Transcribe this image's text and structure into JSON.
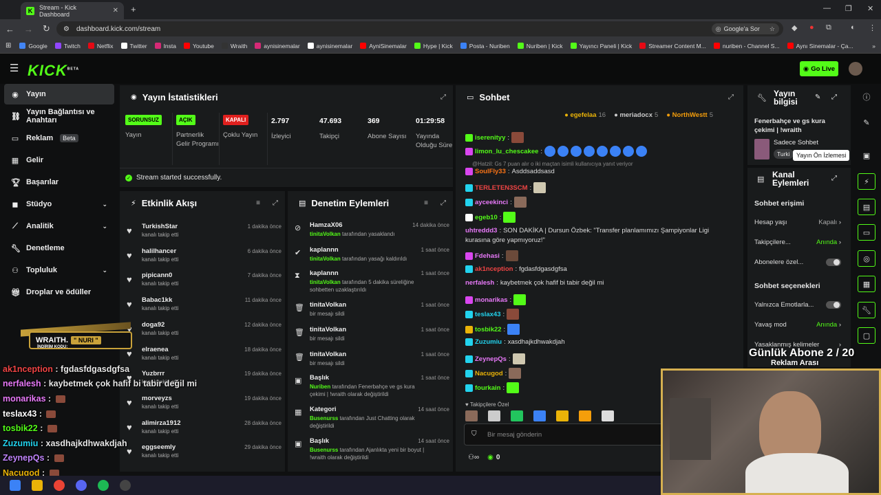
{
  "browser": {
    "tab_title": "Stream - Kick Dashboard",
    "url": "dashboard.kick.com/stream",
    "google_sor": "Google'a Sor",
    "bookmarks": [
      {
        "label": "Google",
        "color": "#4285f4"
      },
      {
        "label": "Twitch",
        "color": "#9146ff"
      },
      {
        "label": "Netflix",
        "color": "#e50914"
      },
      {
        "label": "Twitter",
        "color": "#ffffff"
      },
      {
        "label": "Insta",
        "color": "#d62976"
      },
      {
        "label": "Youtube",
        "color": "#ff0000"
      },
      {
        "label": "Wraith",
        "color": "#333333"
      },
      {
        "label": "aynisinemalar",
        "color": "#d62976"
      },
      {
        "label": "aynisinemalar",
        "color": "#ffffff"
      },
      {
        "label": "AyniSinemalar",
        "color": "#ff0000"
      },
      {
        "label": "Hype | Kick",
        "color": "#53fc18"
      },
      {
        "label": "Posta - Nuriben",
        "color": "#3b82f6"
      },
      {
        "label": "Nuriben | Kick",
        "color": "#53fc18"
      },
      {
        "label": "Yayıncı Paneli | Kick",
        "color": "#53fc18"
      },
      {
        "label": "Streamer Content M...",
        "color": "#e50914"
      },
      {
        "label": "nuriben - Channel S...",
        "color": "#ff0000"
      },
      {
        "label": "Aynı Sinemalar - Ça...",
        "color": "#ff0000"
      }
    ]
  },
  "header": {
    "logo": "KICK",
    "beta": "BETA",
    "go_live": "Go Live"
  },
  "sidebar": [
    {
      "label": "Yayın",
      "icon": "broadcast-icon",
      "active": true
    },
    {
      "label": "Yayın Bağlantısı ve Anahtarı",
      "icon": "link-icon"
    },
    {
      "label": "Reklam",
      "icon": "ad-icon",
      "badge": "Beta"
    },
    {
      "label": "Gelir",
      "icon": "money-icon"
    },
    {
      "label": "Başarılar",
      "icon": "trophy-icon"
    },
    {
      "label": "Stüdyo",
      "icon": "studio-icon",
      "chevron": true
    },
    {
      "label": "Analitik",
      "icon": "chart-icon",
      "chevron": true
    },
    {
      "label": "Denetleme",
      "icon": "wrench-icon"
    },
    {
      "label": "Topluluk",
      "icon": "community-icon",
      "chevron": true
    },
    {
      "label": "Droplar ve ödüller",
      "icon": "gift-icon"
    }
  ],
  "stats": {
    "title": "Yayın İstatistikleri",
    "badges": [
      {
        "badge": "SORUNSUZ",
        "label": "Yayın",
        "color": "#53fc18"
      },
      {
        "badge": "AÇIK",
        "label": "Partnerlik Gelir Programı",
        "color": "#53fc18"
      },
      {
        "badge": "KAPALI",
        "label": "Çoklu Yayın",
        "color": "#e0201e"
      }
    ],
    "numbers": [
      {
        "value": "2.797",
        "label": "İzleyici"
      },
      {
        "value": "47.693",
        "label": "Takipçi"
      },
      {
        "value": "369",
        "label": "Abone Sayısı"
      },
      {
        "value": "01:29:58",
        "label": "Yayında Olduğu Süre"
      }
    ],
    "success": "Stream started successfully."
  },
  "activity": {
    "title": "Etkinlik Akışı",
    "rows": [
      {
        "name": "TurkishStar",
        "sub": "kanalı takip etti",
        "time": "1 dakika önce"
      },
      {
        "name": "halilhancer",
        "sub": "kanalı takip etti",
        "time": "6 dakika önce"
      },
      {
        "name": "pipicann0",
        "sub": "kanalı takip etti",
        "time": "7 dakika önce"
      },
      {
        "name": "Babac1kk",
        "sub": "kanalı takip etti",
        "time": "11 dakika önce"
      },
      {
        "name": "doga92",
        "sub": "kanalı takip etti",
        "time": "12 dakika önce"
      },
      {
        "name": "elraenea",
        "sub": "kanalı takip etti",
        "time": "18 dakika önce"
      },
      {
        "name": "Yuzbrrr",
        "sub": "kanalı takip etti",
        "time": "19 dakika önce"
      },
      {
        "name": "morveyzs",
        "sub": "kanalı takip etti",
        "time": "19 dakika önce"
      },
      {
        "name": "alimirza1912",
        "sub": "kanalı takip etti",
        "time": "28 dakika önce"
      },
      {
        "name": "eggseemly",
        "sub": "kanalı takip etti",
        "time": "29 dakika önce"
      }
    ]
  },
  "moderation": {
    "title": "Denetim Eylemleri",
    "rows": [
      {
        "name": "HamzaX06",
        "actor": "tinitaVolkan",
        "desc": " tarafından yasaklandı",
        "time": "14 dakika önce",
        "icon": "ban-icon"
      },
      {
        "name": "kaplannn",
        "actor": "tinitaVolkan",
        "desc": " tarafından yasağı kaldırıldı",
        "time": "1 saat önce",
        "icon": "check-icon"
      },
      {
        "name": "kaplannn",
        "actor": "tinitaVolkan",
        "desc": " tarafından 5 dakika süreliğine sohbetten uzaklaştırıldı",
        "time": "1 saat önce",
        "icon": "hourglass-icon"
      },
      {
        "name": "tinitaVolkan",
        "actor": "",
        "desc": "bir mesajı sildi",
        "time": "1 saat önce",
        "icon": "trash-icon"
      },
      {
        "name": "tinitaVolkan",
        "actor": "",
        "desc": "bir mesajı sildi",
        "time": "1 saat önce",
        "icon": "trash-icon"
      },
      {
        "name": "tinitaVolkan",
        "actor": "",
        "desc": "bir mesajı sildi",
        "time": "1 saat önce",
        "icon": "trash-icon"
      },
      {
        "name": "Başlık",
        "actor": "Nuriben",
        "desc": " tarafından Fenerbahçe ve gs kura çekimi | !wraith olarak değiştirildi",
        "time": "1 saat önce",
        "icon": "title-icon"
      },
      {
        "name": "Kategori",
        "actor": "Busenurss",
        "desc": " tarafından Just Chatting olarak değiştirildi",
        "time": "14 saat önce",
        "icon": "category-icon"
      },
      {
        "name": "Başlık",
        "actor": "Busenurss",
        "desc": " tarafından Ajanlıkta yeni bir boyut | !wraith olarak değiştirildi",
        "time": "14 saat önce",
        "icon": "title-icon"
      }
    ]
  },
  "chat": {
    "title": "Sohbet",
    "top": [
      {
        "name": "egefelaa",
        "count": "16"
      },
      {
        "name": "meriadocx",
        "count": "5"
      },
      {
        "name": "NorthWestt",
        "count": "5"
      }
    ],
    "reply_note": "@Hatzil: Gs 7 puan alır o iki maçtan isimli kullanıcıya yanıt veriyor",
    "messages": [
      {
        "user": "iserenityy",
        "color": "#53fc18",
        "text": "",
        "badge": "#53fc18",
        "emotes": 1
      },
      {
        "user": "limon_lu_chescakee",
        "color": "#53fc18",
        "text": "",
        "badge": "#d946ef",
        "emotes": 8
      },
      {
        "user": "SoulFly33",
        "color": "#f97316",
        "text": "Asddsaddsasd",
        "badge": "#d946ef",
        "emotes": 0
      },
      {
        "user": "TERLETEN3SCM",
        "color": "#ef4444",
        "text": "",
        "badge": "#22d3ee",
        "emotes": 1
      },
      {
        "user": "ayceekinci",
        "color": "#e879f9",
        "text": "",
        "badge": "#22d3ee",
        "emotes": 1
      },
      {
        "user": "egeb10",
        "color": "#53fc18",
        "text": "",
        "badge": "#ffffff",
        "emotes": 1
      },
      {
        "user": "uhtreddd3",
        "color": "#e879f9",
        "text": "SON DAKİKA | Dursun Özbek: \"Transfer planlamımızı Şampiyonlar Ligi",
        "badge": "",
        "emotes": 0
      },
      {
        "user": "",
        "color": "#ddd",
        "text": "kurasına göre yapmıyoruz!\"",
        "badge": "",
        "emotes": 0
      },
      {
        "user": "Fdehasi",
        "color": "#e879f9",
        "text": "",
        "badge": "#d946ef",
        "emotes": 1
      },
      {
        "user": "ak1nception",
        "color": "#ef4444",
        "text": "fgdasfdgasdgfsa",
        "badge": "#22d3ee",
        "emotes": 0
      },
      {
        "user": "nerfalesh",
        "color": "#e879f9",
        "text": "kaybetmek çok hafif bi tabir değil mi",
        "badge": "",
        "emotes": 0
      },
      {
        "user": "monarikas",
        "color": "#e879f9",
        "text": "",
        "badge": "#d946ef",
        "emotes": 1
      },
      {
        "user": "teslax43",
        "color": "#22d3ee",
        "text": "",
        "badge": "#22d3ee",
        "emotes": 1
      },
      {
        "user": "tosbik22",
        "color": "#53fc18",
        "text": "",
        "badge": "#eab308",
        "emotes": 1
      },
      {
        "user": "Zuzumiu",
        "color": "#22d3ee",
        "text": "xasdhajkdhwakdjah",
        "badge": "#22d3ee",
        "emotes": 0
      },
      {
        "user": "ZeynepQs",
        "color": "#e879f9",
        "text": "",
        "badge": "#22d3ee",
        "emotes": 1
      },
      {
        "user": "Nacugod",
        "color": "#eab308",
        "text": "",
        "badge": "#22d3ee",
        "emotes": 1
      },
      {
        "user": "fourkain",
        "color": "#53fc18",
        "text": "",
        "badge": "#22d3ee",
        "emotes": 1
      }
    ],
    "followers_only": "Takipçilere Özel",
    "input_placeholder": "Bir mesaj gönderin",
    "points": "0"
  },
  "stream_info": {
    "title": "Yayın bilgisi",
    "stream_title": "Fenerbahçe ve gs kura çekimi | !wraith",
    "category": "Sadece Sohbet",
    "lang": "Turki",
    "tooltip": "Yayın Ön İzlemesi"
  },
  "channel_actions": {
    "title": "Kanal Eylemleri",
    "chat_access": "Sohbet erişimi",
    "rows": [
      {
        "label": "Hesap yaşı",
        "value": "Kapalı",
        "type": "link"
      },
      {
        "label": "Takipçilere...",
        "value": "Anında",
        "type": "link"
      },
      {
        "label": "Abonelere özel...",
        "value": "",
        "type": "toggle"
      }
    ],
    "chat_options": "Sohbet seçenekleri",
    "rows2": [
      {
        "label": "Yalnızca Emotlarla...",
        "value": "",
        "type": "toggle"
      },
      {
        "label": "Yavaş mod",
        "value": "Anında",
        "type": "link"
      },
      {
        "label": "Yasaklanmış kelimeler",
        "value": "",
        "type": "link"
      }
    ]
  },
  "overlay": {
    "sub_goal": "Günlük Abone 2 / 20",
    "ad_break": "Reklam Arası",
    "sponsor": "WRAITH.",
    "sponsor_code": "\" NURI \"",
    "sponsor_sub": "İNDİRİM KODU:",
    "chat": [
      {
        "user": "ak1nception",
        "color": "#ef4444",
        "text": " : fgdasfdgasdgfsa"
      },
      {
        "user": "nerfalesh",
        "color": "#e879f9",
        "text": " : kaybetmek çok hafif bi tabir değil mi"
      },
      {
        "user": "monarikas",
        "color": "#e879f9",
        "text": " : "
      },
      {
        "user": "teslax43",
        "color": "#ffffff",
        "text": " : "
      },
      {
        "user": "tosbik22",
        "color": "#53fc18",
        "text": " : "
      },
      {
        "user": "Zuzumiu",
        "color": "#22d3ee",
        "text": " : xasdhajkdhwakdjah"
      },
      {
        "user": "ZeynepQs",
        "color": "#c084fc",
        "text": " : "
      },
      {
        "user": "Nacugod",
        "color": "#eab308",
        "text": " : "
      }
    ]
  }
}
